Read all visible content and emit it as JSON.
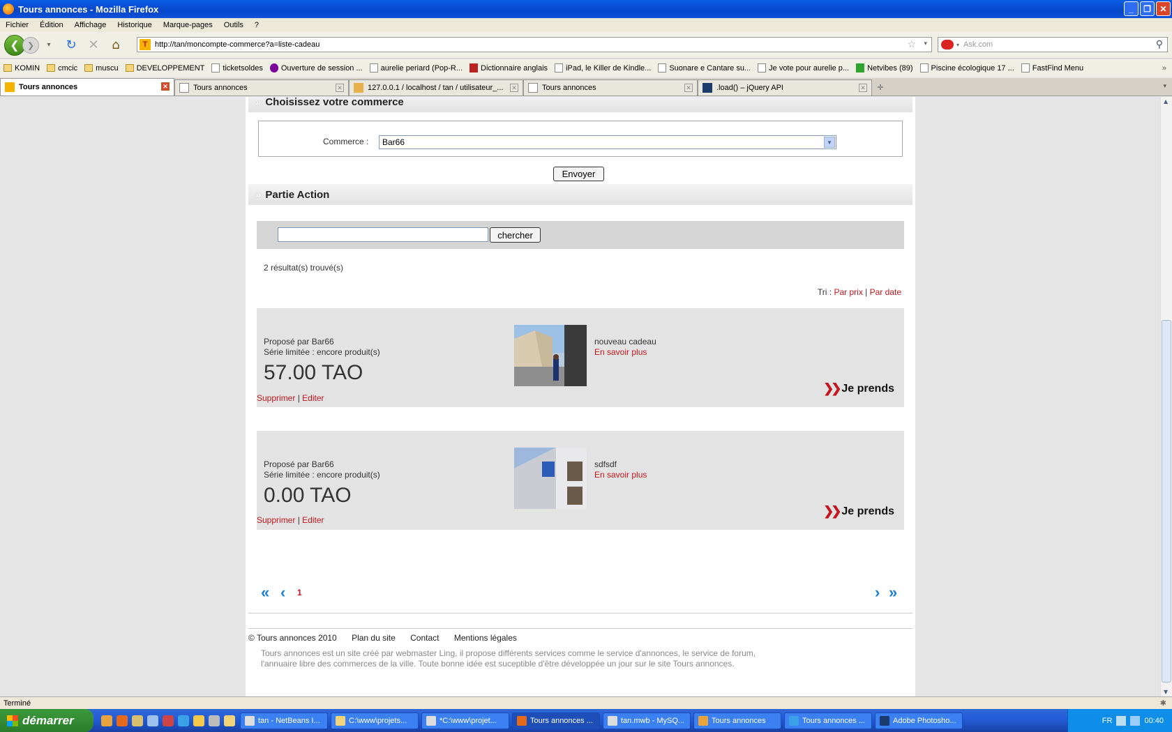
{
  "window": {
    "title": "Tours annonces - Mozilla Firefox"
  },
  "menu": [
    "Fichier",
    "Édition",
    "Affichage",
    "Historique",
    "Marque-pages",
    "Outils",
    "?"
  ],
  "nav": {
    "url": "http://tan/moncompte-commerce?a=liste-cadeau",
    "search_placeholder": "Ask.com",
    "favicon_letter": "T"
  },
  "bookmarks": [
    {
      "label": "KOMIN",
      "type": "folder"
    },
    {
      "label": "cmcic",
      "type": "folder"
    },
    {
      "label": "muscu",
      "type": "folder"
    },
    {
      "label": "DEVELOPPEMENT",
      "type": "folder"
    },
    {
      "label": "ticketsoldes",
      "type": "page"
    },
    {
      "label": "Ouverture de session ...",
      "type": "yahoo"
    },
    {
      "label": "aurelie periard (Pop-R...",
      "type": "page"
    },
    {
      "label": "Dictionnaire anglais",
      "type": "page"
    },
    {
      "label": "iPad, le Killer de Kindle...",
      "type": "page"
    },
    {
      "label": "Suonare e Cantare su...",
      "type": "page"
    },
    {
      "label": "Je vote pour aurelie p...",
      "type": "page"
    },
    {
      "label": "Netvibes (89)",
      "type": "green"
    },
    {
      "label": "Piscine écologique 17 ...",
      "type": "page"
    },
    {
      "label": "FastFind Menu",
      "type": "page"
    }
  ],
  "tabs": [
    {
      "label": "Tours annonces",
      "active": true
    },
    {
      "label": "Tours annonces",
      "active": false
    },
    {
      "label": "127.0.0.1 / localhost / tan / utilisateur_...",
      "active": false
    },
    {
      "label": "Tours annonces",
      "active": false
    },
    {
      "label": ".load() – jQuery API",
      "active": false
    }
  ],
  "page": {
    "section1_title": "Choisissez votre commerce",
    "commerce_label": "Commerce :",
    "commerce_value": "Bar66",
    "send_button": "Envoyer",
    "section2_title": "Partie Action",
    "search_button": "chercher",
    "search_value": "",
    "results_count": "2 résultat(s) trouvé(s)",
    "sort": {
      "label": "Tri :",
      "by_price": "Par prix",
      "separator": "|",
      "by_date": "Par date"
    },
    "items": [
      {
        "proposed_by": "Proposé par Bar66",
        "series": "Série limitée : encore produit(s)",
        "price": "57.00 TAO",
        "name": "nouveau cadeau",
        "more": "En savoir plus",
        "take": "Je prends",
        "delete": "Supprimer",
        "sep": "|",
        "edit": "Editer"
      },
      {
        "proposed_by": "Proposé par Bar66",
        "series": "Série limitée : encore produit(s)",
        "price": "0.00 TAO",
        "name": "sdfsdf",
        "more": "En savoir plus",
        "take": "Je prends",
        "delete": "Supprimer",
        "sep": "|",
        "edit": "Editer"
      }
    ],
    "pager": {
      "current": "1",
      "first": "«",
      "prev": "‹",
      "next": "›",
      "last": "»"
    },
    "footer": {
      "copyright": "© Tours annonces 2010",
      "sitemap": "Plan du site",
      "contact": "Contact",
      "legal": "Mentions légales",
      "description": "Tours annonces est un site créé par webmaster Ling, il propose différents services comme le service d'annonces, le service de forum, l'annuaire libre des commerces de la ville. Toute bonne idée est suceptible d'être développée un jour sur le site Tours annonces."
    }
  },
  "status": "Terminé",
  "taskbar": {
    "start": "démarrer",
    "buttons": [
      "tan - NetBeans I...",
      "C:\\www\\projets...",
      "*C:\\www\\projet...",
      "Tours annonces ...",
      "tan.mwb - MySQ...",
      "Tours annonces",
      "Tours annonces ...",
      "Adobe Photosho..."
    ],
    "lang": "FR",
    "clock": "00:40"
  },
  "colors": {
    "accent_red": "#c4161c",
    "pager_blue": "#1a7fd0",
    "xp_blue": "#245edb"
  }
}
